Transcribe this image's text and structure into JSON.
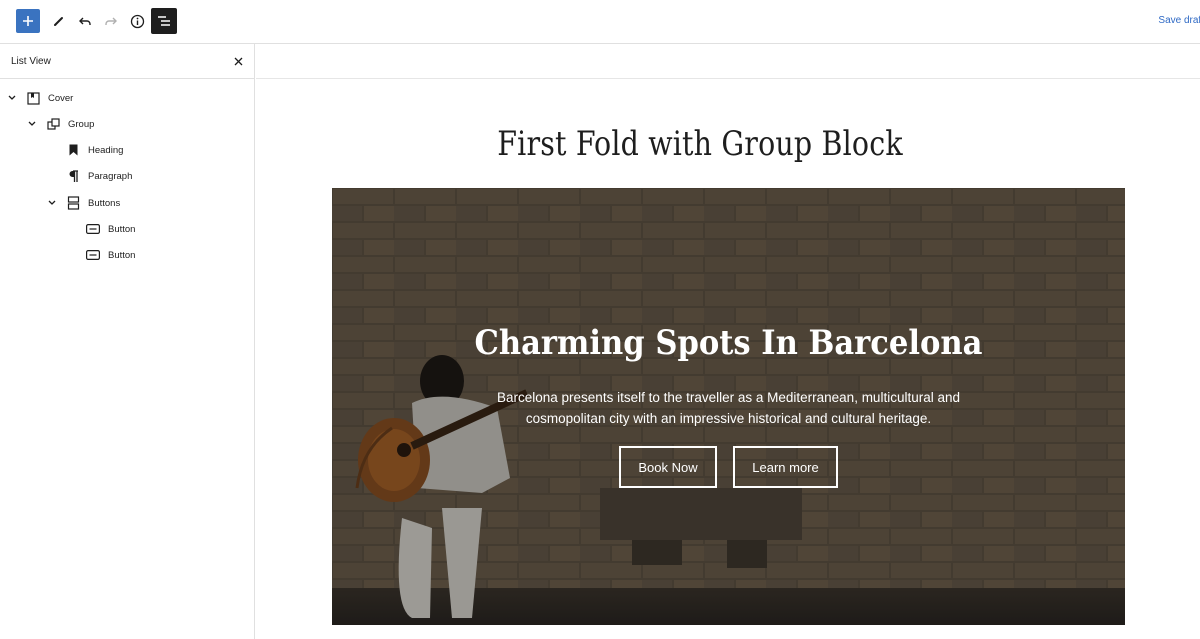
{
  "toolbar": {
    "add_label": "Toggle block inserter",
    "save_label": "Save draft"
  },
  "sidebar": {
    "title": "List View",
    "items": [
      {
        "label": "Cover"
      },
      {
        "label": "Group"
      },
      {
        "label": "Heading"
      },
      {
        "label": "Paragraph"
      },
      {
        "label": "Buttons"
      },
      {
        "label": "Button"
      },
      {
        "label": "Button"
      }
    ]
  },
  "editor": {
    "page_title": "First Fold with Group Block",
    "cover": {
      "heading": "Charming Spots In Barcelona",
      "paragraph": "Barcelona presents itself to the traveller as a Mediterranean, multicultural and cosmopolitan city with an impressive historical and cultural heritage.",
      "buttons": [
        {
          "label": "Book Now"
        },
        {
          "label": "Learn more"
        }
      ]
    }
  },
  "colors": {
    "accent": "#3a73c0",
    "link": "#2f6ac5",
    "dark": "#1e1e1e"
  }
}
